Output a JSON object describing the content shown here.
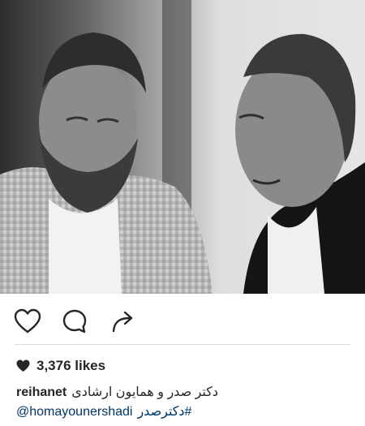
{
  "post": {
    "likes_text": "3,376 likes",
    "username": "reihanet",
    "caption": "دکتر صدر و همایون ارشادی",
    "mention": "@homayounershadi",
    "hashtag": "#دکترصدر"
  },
  "icons": {
    "like": "heart-outline-icon",
    "comment": "comment-bubble-icon",
    "share": "share-arrow-icon",
    "likes": "heart-filled-icon"
  },
  "colors": {
    "text": "#262626",
    "link": "#003569",
    "divider": "#dbdbdb"
  }
}
